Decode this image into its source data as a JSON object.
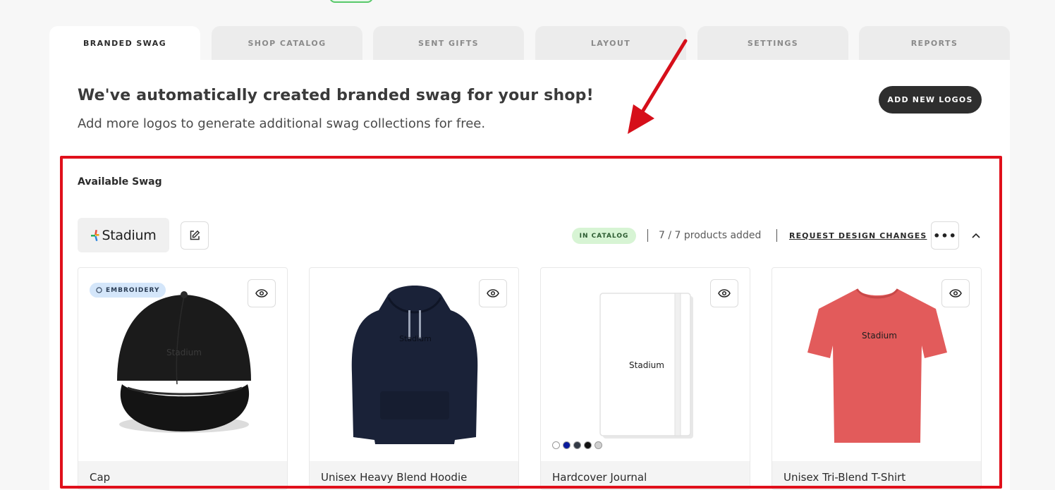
{
  "tabs": [
    {
      "label": "BRANDED SWAG",
      "active": true
    },
    {
      "label": "SHOP CATALOG",
      "active": false
    },
    {
      "label": "SENT GIFTS",
      "active": false
    },
    {
      "label": "LAYOUT",
      "active": false
    },
    {
      "label": "SETTINGS",
      "active": false
    },
    {
      "label": "REPORTS",
      "active": false
    }
  ],
  "hero": {
    "title": "We've automatically created branded swag for your shop!",
    "subtitle": "Add more logos to generate additional swag collections for free.",
    "add_logos_label": "ADD NEW LOGOS"
  },
  "available": {
    "title": "Available Swag",
    "logo_name": "Stadium",
    "status_badge": "IN CATALOG",
    "products_count": "7 / 7 products added",
    "request_link": "REQUEST DESIGN CHANGES",
    "more_label": "•••"
  },
  "products": [
    {
      "name": "Cap",
      "tag": "EMBROIDERY",
      "color": "#1b1b1b"
    },
    {
      "name": "Unisex Heavy Blend Hoodie",
      "color": "#1a2238"
    },
    {
      "name": "Hardcover Journal",
      "color": "#ffffff",
      "swatches": [
        "#ffffff",
        "#0a1a9c",
        "#333a45",
        "#111111",
        "#d0d0d0"
      ]
    },
    {
      "name": "Unisex Tri-Blend T-Shirt",
      "color": "#e25b5b"
    }
  ],
  "colors": {
    "highlight": "#e0101b",
    "badge_bg": "#d7f4d4",
    "tag_bg": "#d4e6fa"
  }
}
